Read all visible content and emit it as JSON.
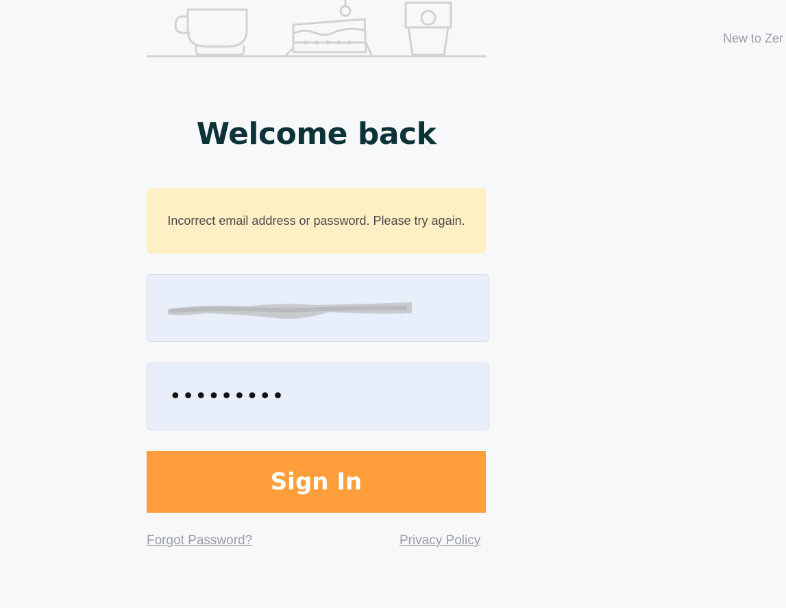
{
  "header": {
    "signup_prompt": "New to Zer"
  },
  "login": {
    "title": "Welcome back",
    "error_message": "Incorrect email address or password. Please try again.",
    "email_value": "",
    "password_value": "•••••••••",
    "sign_in_label": "Sign In",
    "forgot_password_label": "Forgot Password?",
    "privacy_policy_label": "Privacy Policy"
  },
  "colors": {
    "background": "#f6f8fa",
    "title": "#0d3338",
    "alert_bg": "#fef0c4",
    "input_bg": "#e8effb",
    "button": "#ff9e3a",
    "link": "#9a9ea3",
    "illustration_stroke": "#d0d2d4"
  },
  "icons": [
    "coffee-cup-icon",
    "cake-icon",
    "takeaway-cup-icon"
  ]
}
